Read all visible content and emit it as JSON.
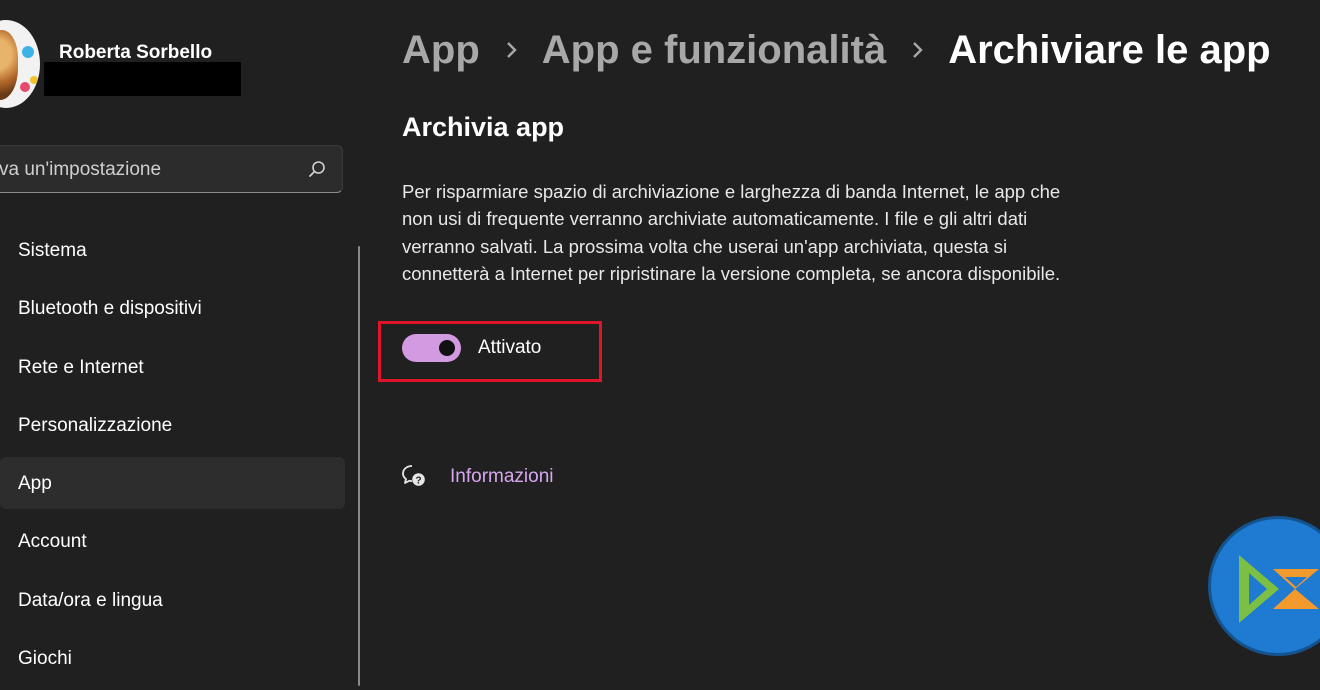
{
  "user": {
    "name": "Roberta Sorbello"
  },
  "search": {
    "text": "va un'impostazione"
  },
  "nav": {
    "items": [
      {
        "label": "Sistema"
      },
      {
        "label": "Bluetooth e dispositivi"
      },
      {
        "label": "Rete e Internet"
      },
      {
        "label": "Personalizzazione"
      },
      {
        "label": "App",
        "active": true
      },
      {
        "label": "Account"
      },
      {
        "label": "Data/ora e lingua"
      },
      {
        "label": "Giochi"
      }
    ]
  },
  "breadcrumb": {
    "items": [
      "App",
      "App e funzionalità",
      "Archiviare le app"
    ]
  },
  "section": {
    "title": "Archivia app",
    "description": "Per risparmiare spazio di archiviazione e larghezza di banda Internet, le app che non usi di frequente verranno archiviate automaticamente. I file e gli altri dati verranno salvati. La prossima volta che userai un'app archiviata, questa si connetterà a Internet per ripristinare la versione completa, se ancora disponibile.",
    "toggle_state": "Attivato",
    "toggle_on": true
  },
  "help": {
    "link": "Informazioni"
  },
  "colors": {
    "background": "#202020",
    "accent": "#d29ae0",
    "link": "#d8a6ee",
    "highlight": "#e0152b"
  }
}
